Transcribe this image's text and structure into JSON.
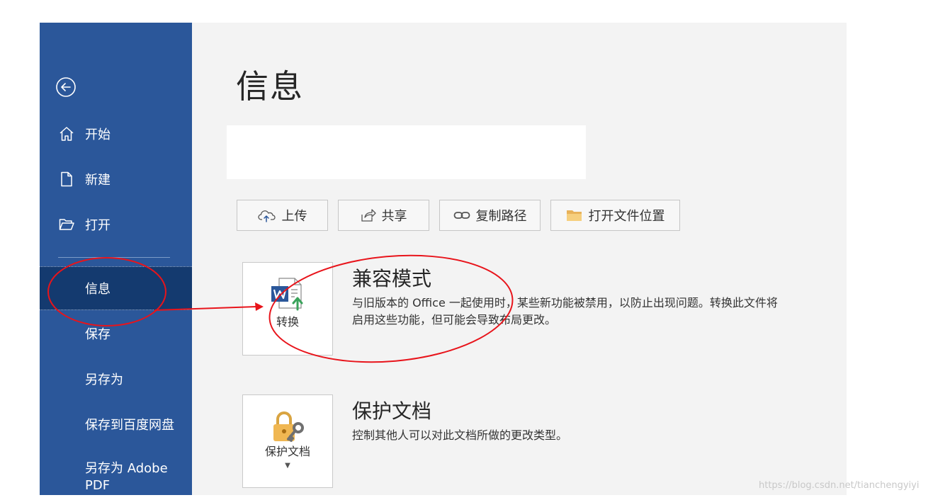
{
  "page": {
    "title": "信息"
  },
  "sidebar": {
    "items": [
      {
        "label": "开始",
        "icon": "home-icon"
      },
      {
        "label": "新建",
        "icon": "new-document-icon"
      },
      {
        "label": "打开",
        "icon": "open-folder-icon"
      },
      {
        "label": "信息"
      },
      {
        "label": "保存"
      },
      {
        "label": "另存为"
      },
      {
        "label": "保存到百度网盘"
      },
      {
        "label": "另存为 Adobe PDF"
      }
    ]
  },
  "toolbar": {
    "upload": "上传",
    "share": "共享",
    "copy_path": "复制路径",
    "open_location": "打开文件位置"
  },
  "compat": {
    "button_label": "转换",
    "title": "兼容模式",
    "desc_line1": "与旧版本的 Office 一起使用时，某些新功能被禁用，以防止出现问题。转换此文件将",
    "desc_line2": "启用这些功能，但可能会导致布局更改。"
  },
  "protect": {
    "button_label": "保护文档",
    "title": "保护文档",
    "desc": "控制其他人可以对此文档所做的更改类型。"
  },
  "watermark": "https://blog.csdn.net/tianchengyiyi",
  "colors": {
    "sidebar": "#2b579a",
    "sidebar_active": "#143a6f",
    "annotation": "#e8141b"
  }
}
